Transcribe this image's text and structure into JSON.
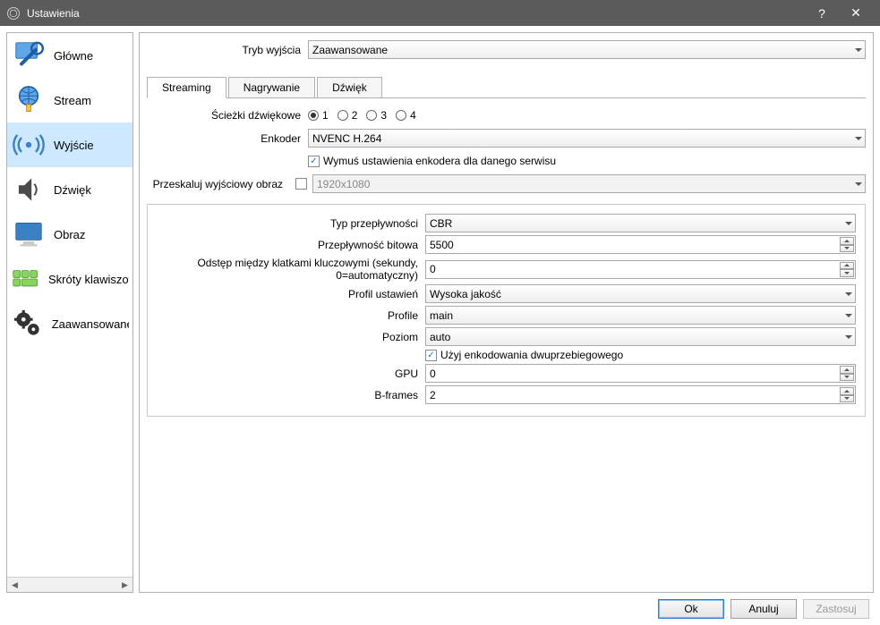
{
  "window": {
    "title": "Ustawienia"
  },
  "sidebar": {
    "items": [
      {
        "label": "Główne"
      },
      {
        "label": "Stream"
      },
      {
        "label": "Wyjście"
      },
      {
        "label": "Dźwięk"
      },
      {
        "label": "Obraz"
      },
      {
        "label": "Skróty klawiszowe"
      },
      {
        "label": "Zaawansowane"
      }
    ],
    "active_index": 2
  },
  "header": {
    "mode_label": "Tryb wyjścia",
    "mode_value": "Zaawansowane"
  },
  "tabs": {
    "items": [
      "Streaming",
      "Nagrywanie",
      "Dźwięk"
    ],
    "active_index": 0
  },
  "streaming": {
    "audio_tracks_label": "Ścieżki dźwiękowe",
    "audio_tracks": {
      "options": [
        "1",
        "2",
        "3",
        "4"
      ],
      "selected": "1"
    },
    "encoder_label": "Enkoder",
    "encoder_value": "NVENC H.264",
    "enforce_label": "Wymuś ustawienia enkodera dla danego serwisu",
    "enforce_checked": true,
    "rescale_label": "Przeskaluj wyjściowy obraz",
    "rescale_value": "1920x1080",
    "rescale_checked": false
  },
  "encoder_settings": {
    "rate_control_label": "Typ przepływności",
    "rate_control_value": "CBR",
    "bitrate_label": "Przepływność bitowa",
    "bitrate_value": "5500",
    "keyint_label": "Odstęp między klatkami kluczowymi (sekundy, 0=automatyczny)",
    "keyint_value": "0",
    "preset_label": "Profil ustawień",
    "preset_value": "Wysoka jakość",
    "profile_label": "Profile",
    "profile_value": "main",
    "level_label": "Poziom",
    "level_value": "auto",
    "twopass_label": "Użyj enkodowania dwuprzebiegowego",
    "twopass_checked": true,
    "gpu_label": "GPU",
    "gpu_value": "0",
    "bframes_label": "B-frames",
    "bframes_value": "2"
  },
  "buttons": {
    "ok": "Ok",
    "cancel": "Anuluj",
    "apply": "Zastosuj"
  }
}
